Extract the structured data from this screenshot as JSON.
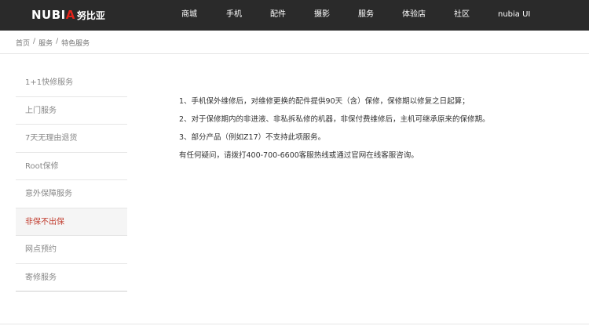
{
  "header": {
    "logo_word_1": "NUBI",
    "logo_word_2": "A",
    "logo_cn": "努比亚",
    "nav": [
      {
        "label": "商城"
      },
      {
        "label": "手机"
      },
      {
        "label": "配件"
      },
      {
        "label": "摄影"
      },
      {
        "label": "服务"
      },
      {
        "label": "体验店"
      },
      {
        "label": "社区"
      },
      {
        "label": "nubia UI"
      }
    ]
  },
  "breadcrumb": {
    "items": [
      "首页",
      "服务",
      "特色服务"
    ],
    "separator": "/"
  },
  "sidebar": {
    "items": [
      {
        "label": "1+1快修服务"
      },
      {
        "label": "上门服务"
      },
      {
        "label": "7天无理由退货"
      },
      {
        "label": "Root保修"
      },
      {
        "label": "意外保障服务"
      },
      {
        "label": "非保不出保"
      },
      {
        "label": "网点预约"
      },
      {
        "label": "寄修服务"
      }
    ],
    "active_index": 5
  },
  "content": {
    "lines": [
      "1、手机保外维修后，对维修更换的配件提供90天（含）保修，保修期以修复之日起算；",
      "2、对于保修期内的非进液、非私拆私修的机器，非保付费维修后，主机可继承原来的保修期。",
      "3、部分产品（例如Z17）不支持此项服务。",
      "有任何疑问，请拨打400-700-6600客服热线或通过官网在线客服咨询。"
    ]
  },
  "colors": {
    "header_bg": "#2a2a2a",
    "accent_red": "#c0392b",
    "logo_red": "#e2231a"
  }
}
